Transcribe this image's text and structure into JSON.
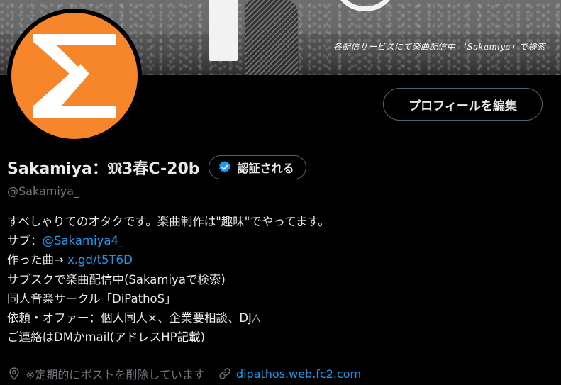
{
  "banner": {
    "caption": "各配信サービスにて楽曲配信中 「Sakamiya」で検索"
  },
  "profile": {
    "display_name": "Sakamiya：𝔐3春C-20b",
    "verify_label": "認証される",
    "handle": "@Sakamiya_",
    "edit_label": "プロフィールを編集"
  },
  "bio": {
    "line1": "すべしゃりてのオタクです。楽曲制作は\"趣味\"でやってます。",
    "line2_prefix": "サブ：",
    "line2_link": "@Sakamiya4_",
    "line3_prefix": "作った曲→ ",
    "line3_link": "x.gd/t5T6D",
    "line4": "サブスクで楽曲配信中(Sakamiyaで検索)",
    "line5": "同人音楽サークル「DiPathoS」",
    "line6": "依頼・オファー：個人同人×、企業要相談、DJ△",
    "line7": "ご連絡はDMかmail(アドレスHP記載)"
  },
  "meta": {
    "location": "※定期的にポストを削除しています",
    "website": "dipathos.web.fc2.com"
  },
  "colors": {
    "accent": "#1d9bf0",
    "avatar_bg": "#f7862a",
    "background": "#000000",
    "muted": "#71767b"
  },
  "icons": {
    "location": "location-pin-icon",
    "website": "link-icon",
    "verified": "verified-badge-icon"
  }
}
